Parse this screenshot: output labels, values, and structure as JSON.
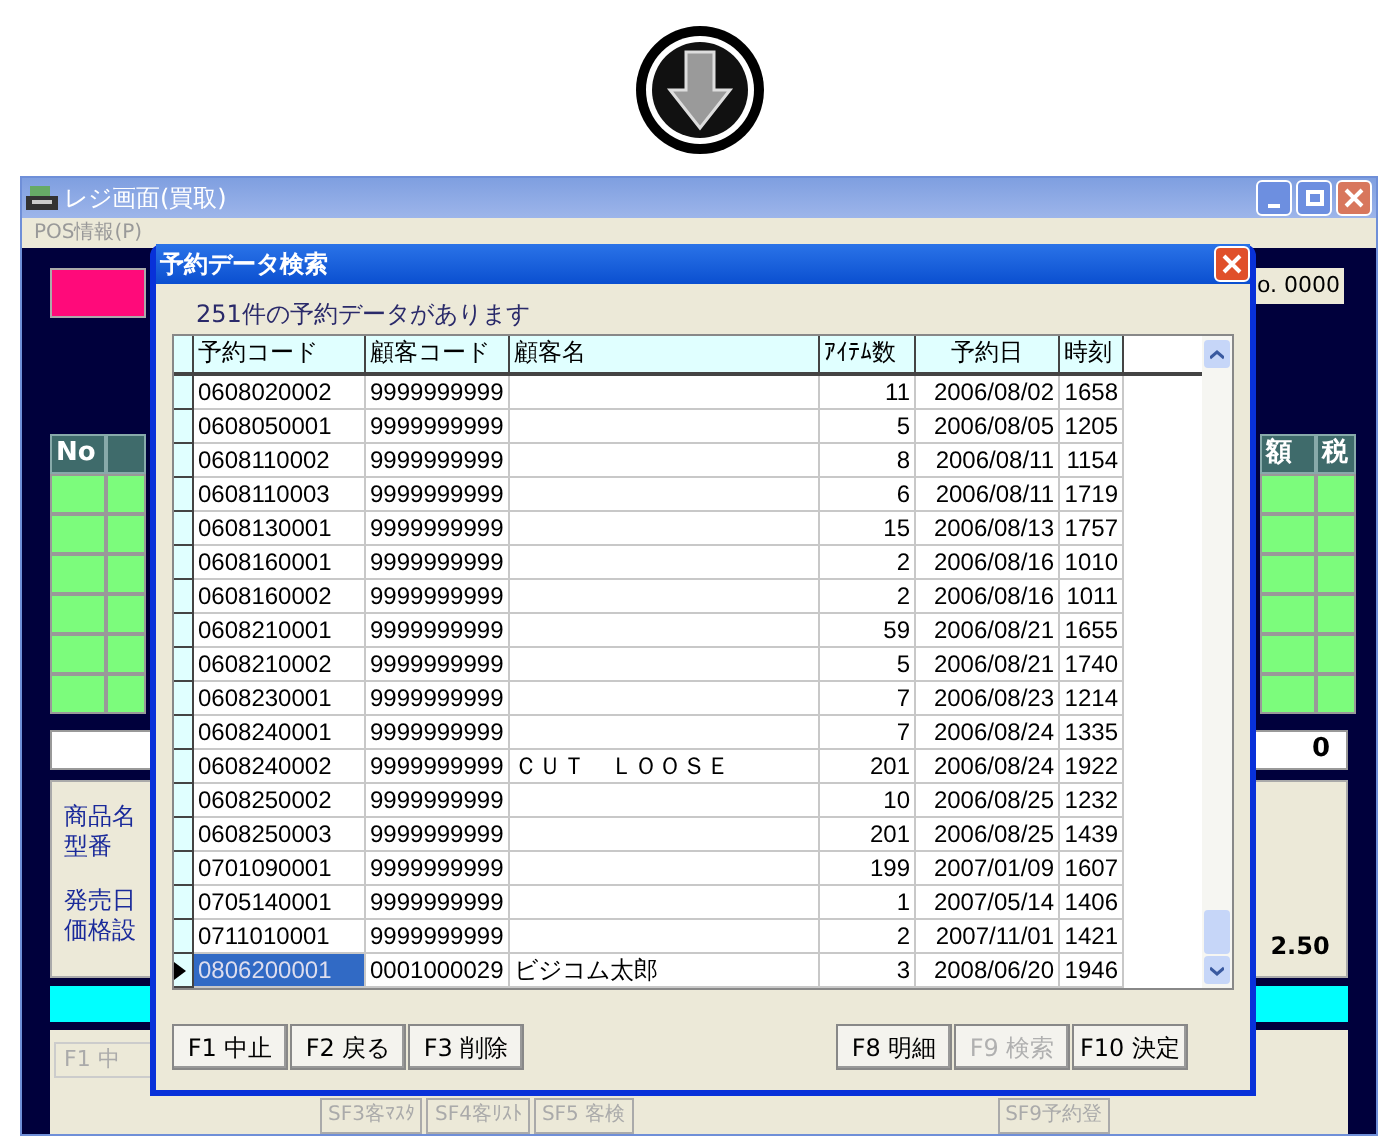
{
  "window": {
    "title": "レジ画面(買取)",
    "menu": [
      "POS情報(P)"
    ],
    "receipt_no": "o. 0000",
    "sales_table": {
      "left_columns": [
        "No",
        ""
      ],
      "right_columns": [
        "額",
        "税"
      ]
    },
    "total": "0",
    "product_labels": [
      "商品名",
      "型番",
      "発売日",
      "価格設"
    ],
    "price_value": "2.50",
    "function_key": "F1 中",
    "bottom_buttons": [
      "SF3客ﾏｽﾀ",
      "SF4客ﾘｽﾄ",
      "SF5 客検",
      "SF9予約登"
    ]
  },
  "dialog": {
    "title": "予約データ検索",
    "message": "251件の予約データがあります",
    "columns": [
      "予約コード",
      "顧客コード",
      "顧客名",
      "ｱｲﾃﾑ数",
      "予約日",
      "時刻"
    ],
    "rows": [
      {
        "code": "0608020002",
        "customer_code": "9999999999",
        "customer_name": "",
        "items": "11",
        "date": "2006/08/02",
        "time": "1658",
        "selected": false
      },
      {
        "code": "0608050001",
        "customer_code": "9999999999",
        "customer_name": "",
        "items": "5",
        "date": "2006/08/05",
        "time": "1205",
        "selected": false
      },
      {
        "code": "0608110002",
        "customer_code": "9999999999",
        "customer_name": "",
        "items": "8",
        "date": "2006/08/11",
        "time": "1154",
        "selected": false
      },
      {
        "code": "0608110003",
        "customer_code": "9999999999",
        "customer_name": "",
        "items": "6",
        "date": "2006/08/11",
        "time": "1719",
        "selected": false
      },
      {
        "code": "0608130001",
        "customer_code": "9999999999",
        "customer_name": "",
        "items": "15",
        "date": "2006/08/13",
        "time": "1757",
        "selected": false
      },
      {
        "code": "0608160001",
        "customer_code": "9999999999",
        "customer_name": "",
        "items": "2",
        "date": "2006/08/16",
        "time": "1010",
        "selected": false
      },
      {
        "code": "0608160002",
        "customer_code": "9999999999",
        "customer_name": "",
        "items": "2",
        "date": "2006/08/16",
        "time": "1011",
        "selected": false
      },
      {
        "code": "0608210001",
        "customer_code": "9999999999",
        "customer_name": "",
        "items": "59",
        "date": "2006/08/21",
        "time": "1655",
        "selected": false
      },
      {
        "code": "0608210002",
        "customer_code": "9999999999",
        "customer_name": "",
        "items": "5",
        "date": "2006/08/21",
        "time": "1740",
        "selected": false
      },
      {
        "code": "0608230001",
        "customer_code": "9999999999",
        "customer_name": "",
        "items": "7",
        "date": "2006/08/23",
        "time": "1214",
        "selected": false
      },
      {
        "code": "0608240001",
        "customer_code": "9999999999",
        "customer_name": "",
        "items": "7",
        "date": "2006/08/24",
        "time": "1335",
        "selected": false
      },
      {
        "code": "0608240002",
        "customer_code": "9999999999",
        "customer_name": "ＣＵＴ　ＬＯＯＳＥ",
        "items": "201",
        "date": "2006/08/24",
        "time": "1922",
        "selected": false
      },
      {
        "code": "0608250002",
        "customer_code": "9999999999",
        "customer_name": "",
        "items": "10",
        "date": "2006/08/25",
        "time": "1232",
        "selected": false
      },
      {
        "code": "0608250003",
        "customer_code": "9999999999",
        "customer_name": "",
        "items": "201",
        "date": "2006/08/25",
        "time": "1439",
        "selected": false
      },
      {
        "code": "0701090001",
        "customer_code": "9999999999",
        "customer_name": "",
        "items": "199",
        "date": "2007/01/09",
        "time": "1607",
        "selected": false
      },
      {
        "code": "0705140001",
        "customer_code": "9999999999",
        "customer_name": "",
        "items": "1",
        "date": "2007/05/14",
        "time": "1406",
        "selected": false
      },
      {
        "code": "0711010001",
        "customer_code": "9999999999",
        "customer_name": "",
        "items": "2",
        "date": "2007/11/01",
        "time": "1421",
        "selected": false
      },
      {
        "code": "0806200001",
        "customer_code": "0001000029",
        "customer_name": "ビジコム太郎",
        "items": "3",
        "date": "2008/06/20",
        "time": "1946",
        "selected": true
      }
    ],
    "left_buttons": [
      {
        "label": "F1 中止",
        "disabled": false
      },
      {
        "label": "F2 戻る",
        "disabled": false
      },
      {
        "label": "F3 削除",
        "disabled": false
      }
    ],
    "right_buttons": [
      {
        "label": "F8 明細",
        "disabled": false
      },
      {
        "label": "F9 検索",
        "disabled": true
      },
      {
        "label": "F10 決定",
        "disabled": false
      }
    ]
  }
}
